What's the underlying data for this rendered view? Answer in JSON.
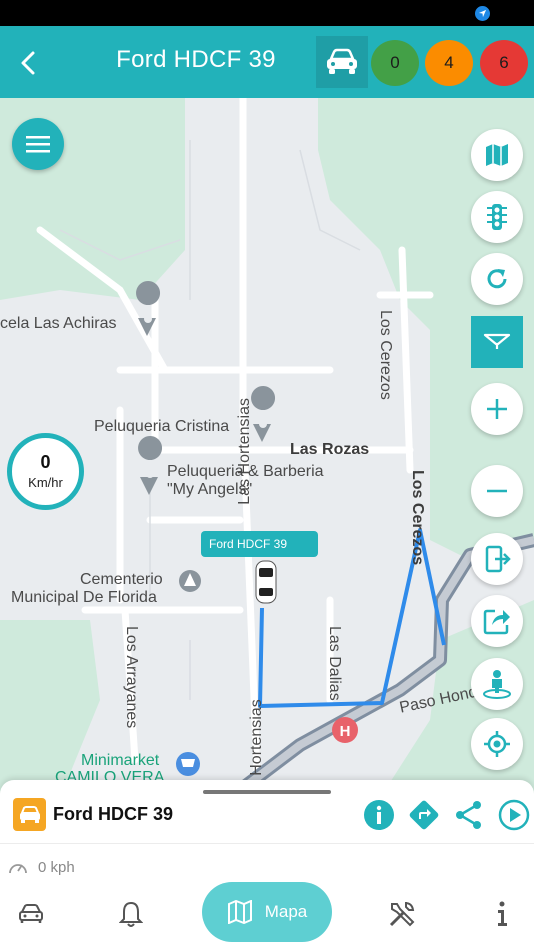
{
  "header": {
    "title": "Ford HDCF 39",
    "counts": {
      "green": "0",
      "orange": "4",
      "red": "6"
    }
  },
  "map": {
    "labels": {
      "hortensias_top": "Las Hortensias",
      "achiras": "cela Las Achiras",
      "cerezos_top": "Los Cerezos",
      "peluqueria_cristina": "Peluqueria Cristina",
      "rozas": "Las Rozas",
      "peluqueria_barberia_1": "Peluqueria & Barberia",
      "peluqueria_barberia_2": "\"My Angels\"",
      "cerezos_mid": "Los Cerezos",
      "cementerio_1": "Cementerio",
      "cementerio_2": "Municipal De Florida",
      "arrayanes": "Los Arrayanes",
      "hortensias_bottom": "Las Hortensias",
      "dalias": "Las Dalias",
      "paso_hondo": "Paso Hondo",
      "minimarket_1": "Minimarket",
      "minimarket_2": "CAMILO VERA"
    },
    "vehicle_tag": "Ford HDCF 39",
    "speed_gauge": {
      "value": "0",
      "unit": "Km/hr"
    }
  },
  "bottom_sheet": {
    "vehicle_name": "Ford HDCF 39",
    "speed": "0 kph"
  },
  "nav": {
    "map_label": "Mapa"
  },
  "colors": {
    "primary": "#22b2ba",
    "route": "#2f8bea",
    "orange": "#fb8c00",
    "red": "#e53935",
    "green": "#43a047"
  },
  "icons": {
    "header": [
      "back-arrow-icon",
      "car-icon"
    ],
    "side": [
      "map-icon",
      "traffic-light-icon",
      "refresh-icon",
      "funnel-icon",
      "zoom-in-icon",
      "zoom-out-icon",
      "exit-icon",
      "share-square-icon",
      "street-view-icon",
      "my-location-icon"
    ],
    "sheet": [
      "info-icon",
      "directions-icon",
      "share-icon",
      "play-icon",
      "speedometer-icon"
    ],
    "nav": [
      "car-icon",
      "bell-icon",
      "map-icon",
      "tools-icon",
      "info-icon"
    ]
  }
}
